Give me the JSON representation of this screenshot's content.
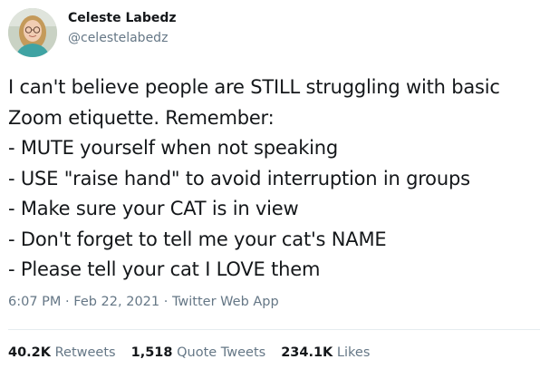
{
  "author": {
    "display_name": "Celeste Labedz",
    "handle": "@celestelabedz"
  },
  "tweet": {
    "lines": [
      "I can't believe people are STILL struggling with basic",
      "Zoom etiquette. Remember:",
      "- MUTE yourself when not speaking",
      "- USE \"raise hand\" to avoid interruption in groups",
      "- Make sure your CAT is in view",
      "- Don't forget to tell me your cat's NAME",
      "- Please tell your cat I LOVE them"
    ]
  },
  "meta": {
    "time": "6:07 PM",
    "sep1": " · ",
    "date": "Feb 22, 2021",
    "sep2": " · ",
    "source": "Twitter Web App"
  },
  "stats": {
    "retweets_count": "40.2K",
    "retweets_label": "Retweets",
    "quotes_count": "1,518",
    "quotes_label": "Quote Tweets",
    "likes_count": "234.1K",
    "likes_label": "Likes"
  },
  "colors": {
    "text": "#14171a",
    "secondary": "#657786",
    "divider": "#e6ecf0"
  }
}
